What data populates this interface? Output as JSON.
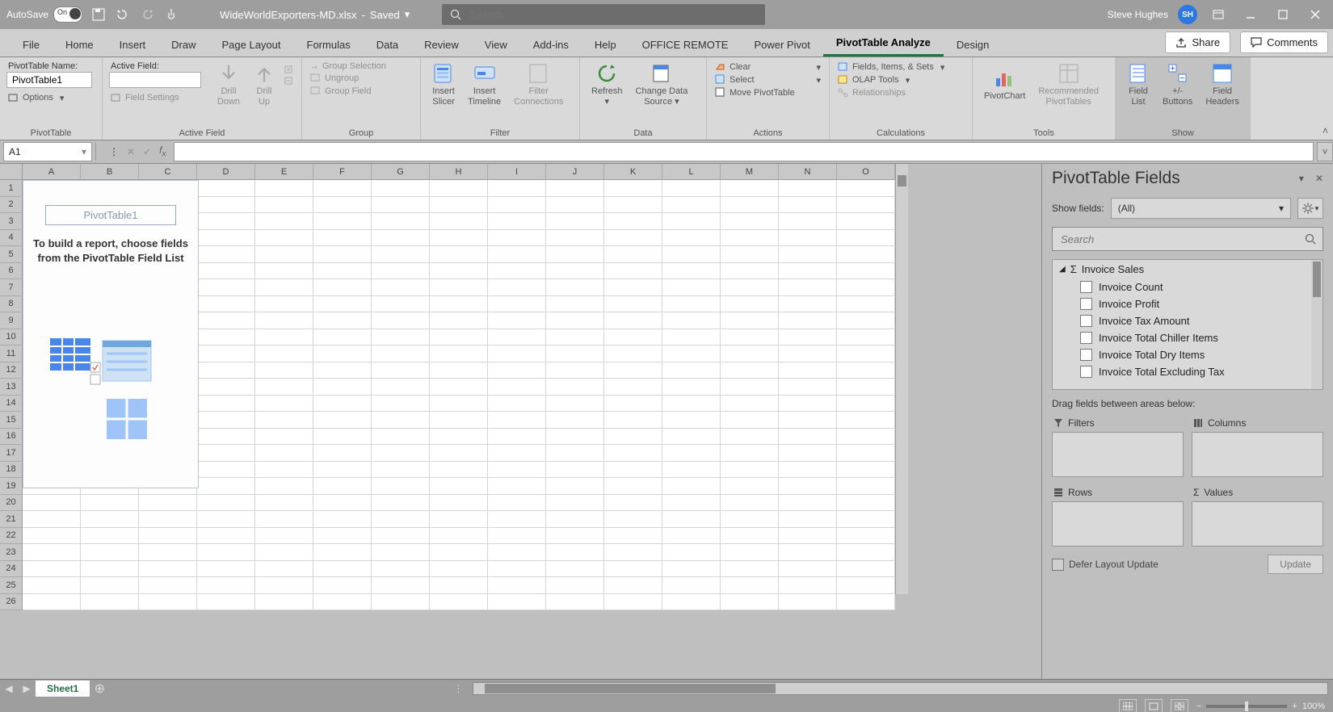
{
  "titlebar": {
    "autosave_label": "AutoSave",
    "autosave_state": "On",
    "filename": "WideWorldExporters-MD.xlsx",
    "saved_state": "Saved",
    "search_placeholder": "Search",
    "user_name": "Steve Hughes",
    "user_initials": "SH"
  },
  "tabs": {
    "items": [
      "File",
      "Home",
      "Insert",
      "Draw",
      "Page Layout",
      "Formulas",
      "Data",
      "Review",
      "View",
      "Add-ins",
      "Help",
      "OFFICE REMOTE",
      "Power Pivot",
      "PivotTable Analyze",
      "Design"
    ],
    "active_index": 13,
    "share": "Share",
    "comments": "Comments"
  },
  "ribbon": {
    "pt_name_label": "PivotTable Name:",
    "pt_name_value": "PivotTable1",
    "options": "Options",
    "grp_pivottable": "PivotTable",
    "active_field_label": "Active Field:",
    "drill_down": "Drill\nDown",
    "drill_up": "Drill\nUp",
    "field_settings": "Field Settings",
    "grp_active_field": "Active Field",
    "group_selection": "Group Selection",
    "ungroup": "Ungroup",
    "group_field": "Group Field",
    "grp_group": "Group",
    "insert_slicer": "Insert\nSlicer",
    "insert_timeline": "Insert\nTimeline",
    "filter_connections": "Filter\nConnections",
    "grp_filter": "Filter",
    "refresh": "Refresh",
    "change_data_source": "Change Data\nSource",
    "grp_data": "Data",
    "clear": "Clear",
    "select": "Select",
    "move_pivottable": "Move PivotTable",
    "grp_actions": "Actions",
    "fields_items_sets": "Fields, Items, & Sets",
    "olap_tools": "OLAP Tools",
    "relationships": "Relationships",
    "grp_calculations": "Calculations",
    "pivotchart": "PivotChart",
    "recommended_pivottables": "Recommended\nPivotTables",
    "grp_tools": "Tools",
    "field_list": "Field\nList",
    "pm_buttons": "+/-\nButtons",
    "field_headers": "Field\nHeaders",
    "grp_show": "Show"
  },
  "formula_bar": {
    "cell_ref": "A1"
  },
  "sheet": {
    "columns": [
      "A",
      "B",
      "C",
      "D",
      "E",
      "F",
      "G",
      "H",
      "I",
      "J",
      "K",
      "L",
      "M",
      "N",
      "O"
    ],
    "rows": [
      "1",
      "2",
      "3",
      "4",
      "5",
      "6",
      "7",
      "8",
      "9",
      "10",
      "11",
      "12",
      "13",
      "14",
      "15",
      "16",
      "17",
      "18",
      "19",
      "20",
      "21",
      "22",
      "23",
      "24",
      "25",
      "26"
    ],
    "placeholder_title": "PivotTable1",
    "placeholder_msg": "To build a report, choose fields from the PivotTable Field List"
  },
  "tabsbar": {
    "sheet_name": "Sheet1"
  },
  "sidepanel": {
    "title": "PivotTable Fields",
    "show_fields_label": "Show fields:",
    "show_fields_value": "(All)",
    "search_placeholder": "Search",
    "group_name": "Invoice Sales",
    "fields": [
      "Invoice Count",
      "Invoice Profit",
      "Invoice Tax Amount",
      "Invoice Total Chiller Items",
      "Invoice Total Dry Items",
      "Invoice Total Excluding Tax"
    ],
    "drag_label": "Drag fields between areas below:",
    "area_filters": "Filters",
    "area_columns": "Columns",
    "area_rows": "Rows",
    "area_values": "Values",
    "defer_label": "Defer Layout Update",
    "update": "Update"
  },
  "statusbar": {
    "zoom": "100%"
  }
}
